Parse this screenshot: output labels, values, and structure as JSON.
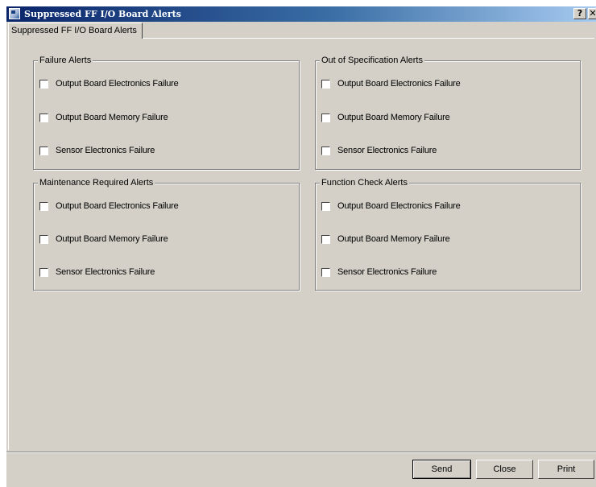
{
  "window": {
    "title": "Suppressed FF I/O Board Alerts",
    "help_label": "?",
    "close_label": "✕"
  },
  "tab": {
    "label": "Suppressed FF I/O Board Alerts"
  },
  "groups": [
    {
      "title": "Failure Alerts",
      "items": [
        {
          "label": "Output Board Electronics Failure",
          "checked": false
        },
        {
          "label": "Output Board Memory Failure",
          "checked": false
        },
        {
          "label": "Sensor Electronics Failure",
          "checked": false
        }
      ]
    },
    {
      "title": "Out of Specification Alerts",
      "items": [
        {
          "label": "Output Board Electronics Failure",
          "checked": false
        },
        {
          "label": "Output Board Memory Failure",
          "checked": false
        },
        {
          "label": "Sensor Electronics Failure",
          "checked": false
        }
      ]
    },
    {
      "title": "Maintenance Required Alerts",
      "items": [
        {
          "label": "Output Board Electronics Failure",
          "checked": false
        },
        {
          "label": "Output Board Memory Failure",
          "checked": false
        },
        {
          "label": "Sensor Electronics Failure",
          "checked": false
        }
      ]
    },
    {
      "title": "Function Check Alerts",
      "items": [
        {
          "label": "Output Board Electronics Failure",
          "checked": false
        },
        {
          "label": "Output Board Memory Failure",
          "checked": false
        },
        {
          "label": "Sensor Electronics Failure",
          "checked": false
        }
      ]
    }
  ],
  "buttons": {
    "send": "Send",
    "close": "Close",
    "print": "Print"
  }
}
